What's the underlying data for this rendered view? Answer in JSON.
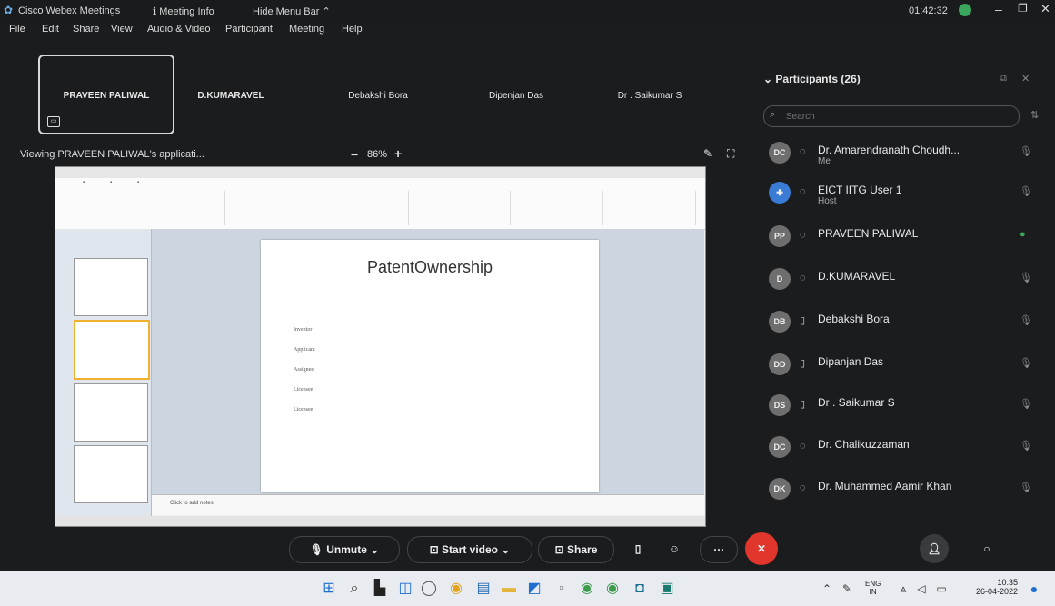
{
  "window": {
    "app_title": "Cisco Webex Meetings",
    "meeting_info": "Meeting Info",
    "hide_menu_bar": "Hide Menu Bar",
    "timer": "01:42:32"
  },
  "menu": [
    "File",
    "Edit",
    "Share",
    "View",
    "Audio & Video",
    "Participant",
    "Meeting",
    "Help"
  ],
  "video_strip": [
    "PRAVEEN PALIWAL",
    "D.KUMARAVEL",
    "Debakshi Bora",
    "Dipenjan Das",
    "Dr . Saikumar S"
  ],
  "viewing": {
    "label": "Viewing PRAVEEN PALIWAL's applicati...",
    "zoom_minus": "−",
    "zoom": "86%",
    "zoom_plus": "+"
  },
  "shared_slide": {
    "title": "PatentOwnership",
    "bullets": [
      "Inventor",
      "Applicant",
      "Assignee",
      "Licensee",
      "Licensee"
    ],
    "notes_placeholder": "Click to add notes"
  },
  "participants": {
    "header": "Participants (26)",
    "search_placeholder": "Search",
    "items": [
      {
        "initials": "DC",
        "name": "Dr. Amarendranath Choudh...",
        "role": "Me"
      },
      {
        "initials": "",
        "name": "EICT IITG User 1",
        "role": "Host"
      },
      {
        "initials": "PP",
        "name": "PRAVEEN PALIWAL",
        "role": ""
      },
      {
        "initials": "D",
        "name": "D.KUMARAVEL",
        "role": ""
      },
      {
        "initials": "DB",
        "name": "Debakshi Bora",
        "role": ""
      },
      {
        "initials": "DD",
        "name": "Dipanjan Das",
        "role": ""
      },
      {
        "initials": "DS",
        "name": "Dr . Saikumar S",
        "role": ""
      },
      {
        "initials": "DC",
        "name": "Dr. Chalikuzzaman",
        "role": ""
      },
      {
        "initials": "DK",
        "name": "Dr. Muhammed Aamir Khan",
        "role": ""
      }
    ]
  },
  "controls": {
    "unmute": "Unmute",
    "start_video": "Start video",
    "share": "Share"
  },
  "taskbar": {
    "lang_top": "ENG",
    "lang_bottom": "IN",
    "time": "10:35",
    "date": "26-04-2022"
  },
  "colors": {
    "leave_button": "#e0362c",
    "background": "#1b1c1e",
    "panel_text": "#eaeaea",
    "taskbar": "#e8ebef",
    "webex_green": "#3aa55d"
  }
}
